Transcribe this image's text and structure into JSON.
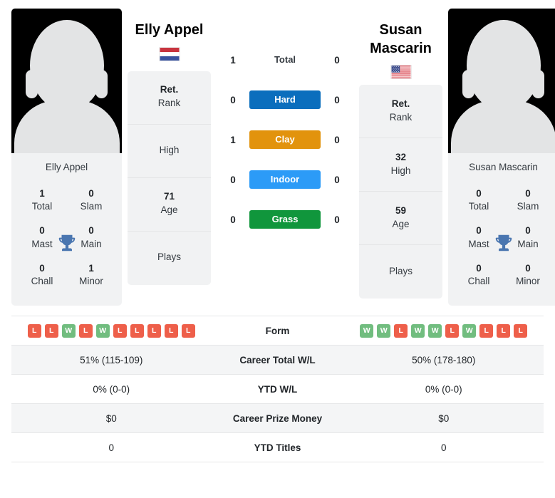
{
  "players": {
    "left": {
      "name": "Elly Appel",
      "photo_caption": "Elly Appel",
      "flag": "netherlands-flag",
      "titles": [
        {
          "value": "1",
          "label": "Total"
        },
        {
          "value": "0",
          "label": "Slam"
        },
        {
          "value": "0",
          "label": "Mast"
        },
        {
          "value": "0",
          "label": "Main"
        },
        {
          "value": "0",
          "label": "Chall"
        },
        {
          "value": "1",
          "label": "Minor"
        }
      ],
      "info": [
        {
          "value": "Ret.",
          "label": "Rank"
        },
        {
          "value": "",
          "label": "High"
        },
        {
          "value": "71",
          "label": "Age"
        },
        {
          "value": "",
          "label": "Plays"
        }
      ],
      "form": [
        "L",
        "L",
        "W",
        "L",
        "W",
        "L",
        "L",
        "L",
        "L",
        "L"
      ],
      "stats": {
        "career_total_wl": "51% (115-109)",
        "ytd_wl": "0% (0-0)",
        "career_prize_money": "$0",
        "ytd_titles": "0"
      }
    },
    "right": {
      "name": "Susan Mascarin",
      "photo_caption": "Susan Mascarin",
      "flag": "usa-flag",
      "titles": [
        {
          "value": "0",
          "label": "Total"
        },
        {
          "value": "0",
          "label": "Slam"
        },
        {
          "value": "0",
          "label": "Mast"
        },
        {
          "value": "0",
          "label": "Main"
        },
        {
          "value": "0",
          "label": "Chall"
        },
        {
          "value": "0",
          "label": "Minor"
        }
      ],
      "info": [
        {
          "value": "Ret.",
          "label": "Rank"
        },
        {
          "value": "32",
          "label": "High"
        },
        {
          "value": "59",
          "label": "Age"
        },
        {
          "value": "",
          "label": "Plays"
        }
      ],
      "form": [
        "W",
        "W",
        "L",
        "W",
        "W",
        "L",
        "W",
        "L",
        "L",
        "L"
      ],
      "stats": {
        "career_total_wl": "50% (178-180)",
        "ytd_wl": "0% (0-0)",
        "career_prize_money": "$0",
        "ytd_titles": "0"
      }
    }
  },
  "head_to_head": [
    {
      "label": "Total",
      "left": "1",
      "right": "0",
      "badge": false,
      "color": ""
    },
    {
      "label": "Hard",
      "left": "0",
      "right": "0",
      "badge": true,
      "color": "#0b6ebd"
    },
    {
      "label": "Clay",
      "left": "1",
      "right": "0",
      "badge": true,
      "color": "#e2930d"
    },
    {
      "label": "Indoor",
      "left": "0",
      "right": "0",
      "badge": true,
      "color": "#2c9bf7"
    },
    {
      "label": "Grass",
      "left": "0",
      "right": "0",
      "badge": true,
      "color": "#10963c"
    }
  ],
  "stats_table": {
    "rows": [
      {
        "label": "Form",
        "key": "form",
        "type": "form"
      },
      {
        "label": "Career Total W/L",
        "key": "career_total_wl",
        "type": "text"
      },
      {
        "label": "YTD W/L",
        "key": "ytd_wl",
        "type": "text"
      },
      {
        "label": "Career Prize Money",
        "key": "career_prize_money",
        "type": "text"
      },
      {
        "label": "YTD Titles",
        "key": "ytd_titles",
        "type": "text"
      }
    ]
  },
  "icons": {
    "trophy": "trophy-icon"
  },
  "colors": {
    "win": "#71bd7f",
    "loss": "#ee5f4a",
    "hard": "#0b6ebd",
    "clay": "#e2930d",
    "indoor": "#2c9bf7",
    "grass": "#10963c"
  }
}
